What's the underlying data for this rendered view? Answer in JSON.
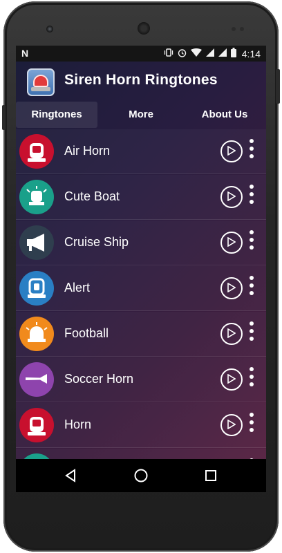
{
  "status_bar": {
    "time": "4:14",
    "icons": [
      "n-logo",
      "vibrate-icon",
      "alarm-icon",
      "wifi-icon",
      "signal-icon",
      "signal-icon",
      "battery-icon"
    ]
  },
  "app": {
    "title": "Siren Horn Ringtones"
  },
  "tabs": [
    {
      "label": "Ringtones",
      "active": true
    },
    {
      "label": "More",
      "active": false
    },
    {
      "label": "About Us",
      "active": false
    }
  ],
  "ringtones": [
    {
      "label": "Air Horn",
      "icon": "siren-icon",
      "color": "#c8102e"
    },
    {
      "label": "Cute Boat",
      "icon": "beacon-icon",
      "color": "#1aa08a"
    },
    {
      "label": "Cruise Ship",
      "icon": "megaphone-icon",
      "color": "#2f3e4e"
    },
    {
      "label": "Alert",
      "icon": "alarm-light-icon",
      "color": "#2a7fc4"
    },
    {
      "label": "Football",
      "icon": "beacon-icon",
      "color": "#f18a1c"
    },
    {
      "label": "Soccer Horn",
      "icon": "vuvuzela-icon",
      "color": "#8e44ad"
    },
    {
      "label": "Horn",
      "icon": "siren-icon",
      "color": "#c8102e"
    }
  ],
  "navigation": [
    "back-icon",
    "home-icon",
    "recents-icon"
  ]
}
